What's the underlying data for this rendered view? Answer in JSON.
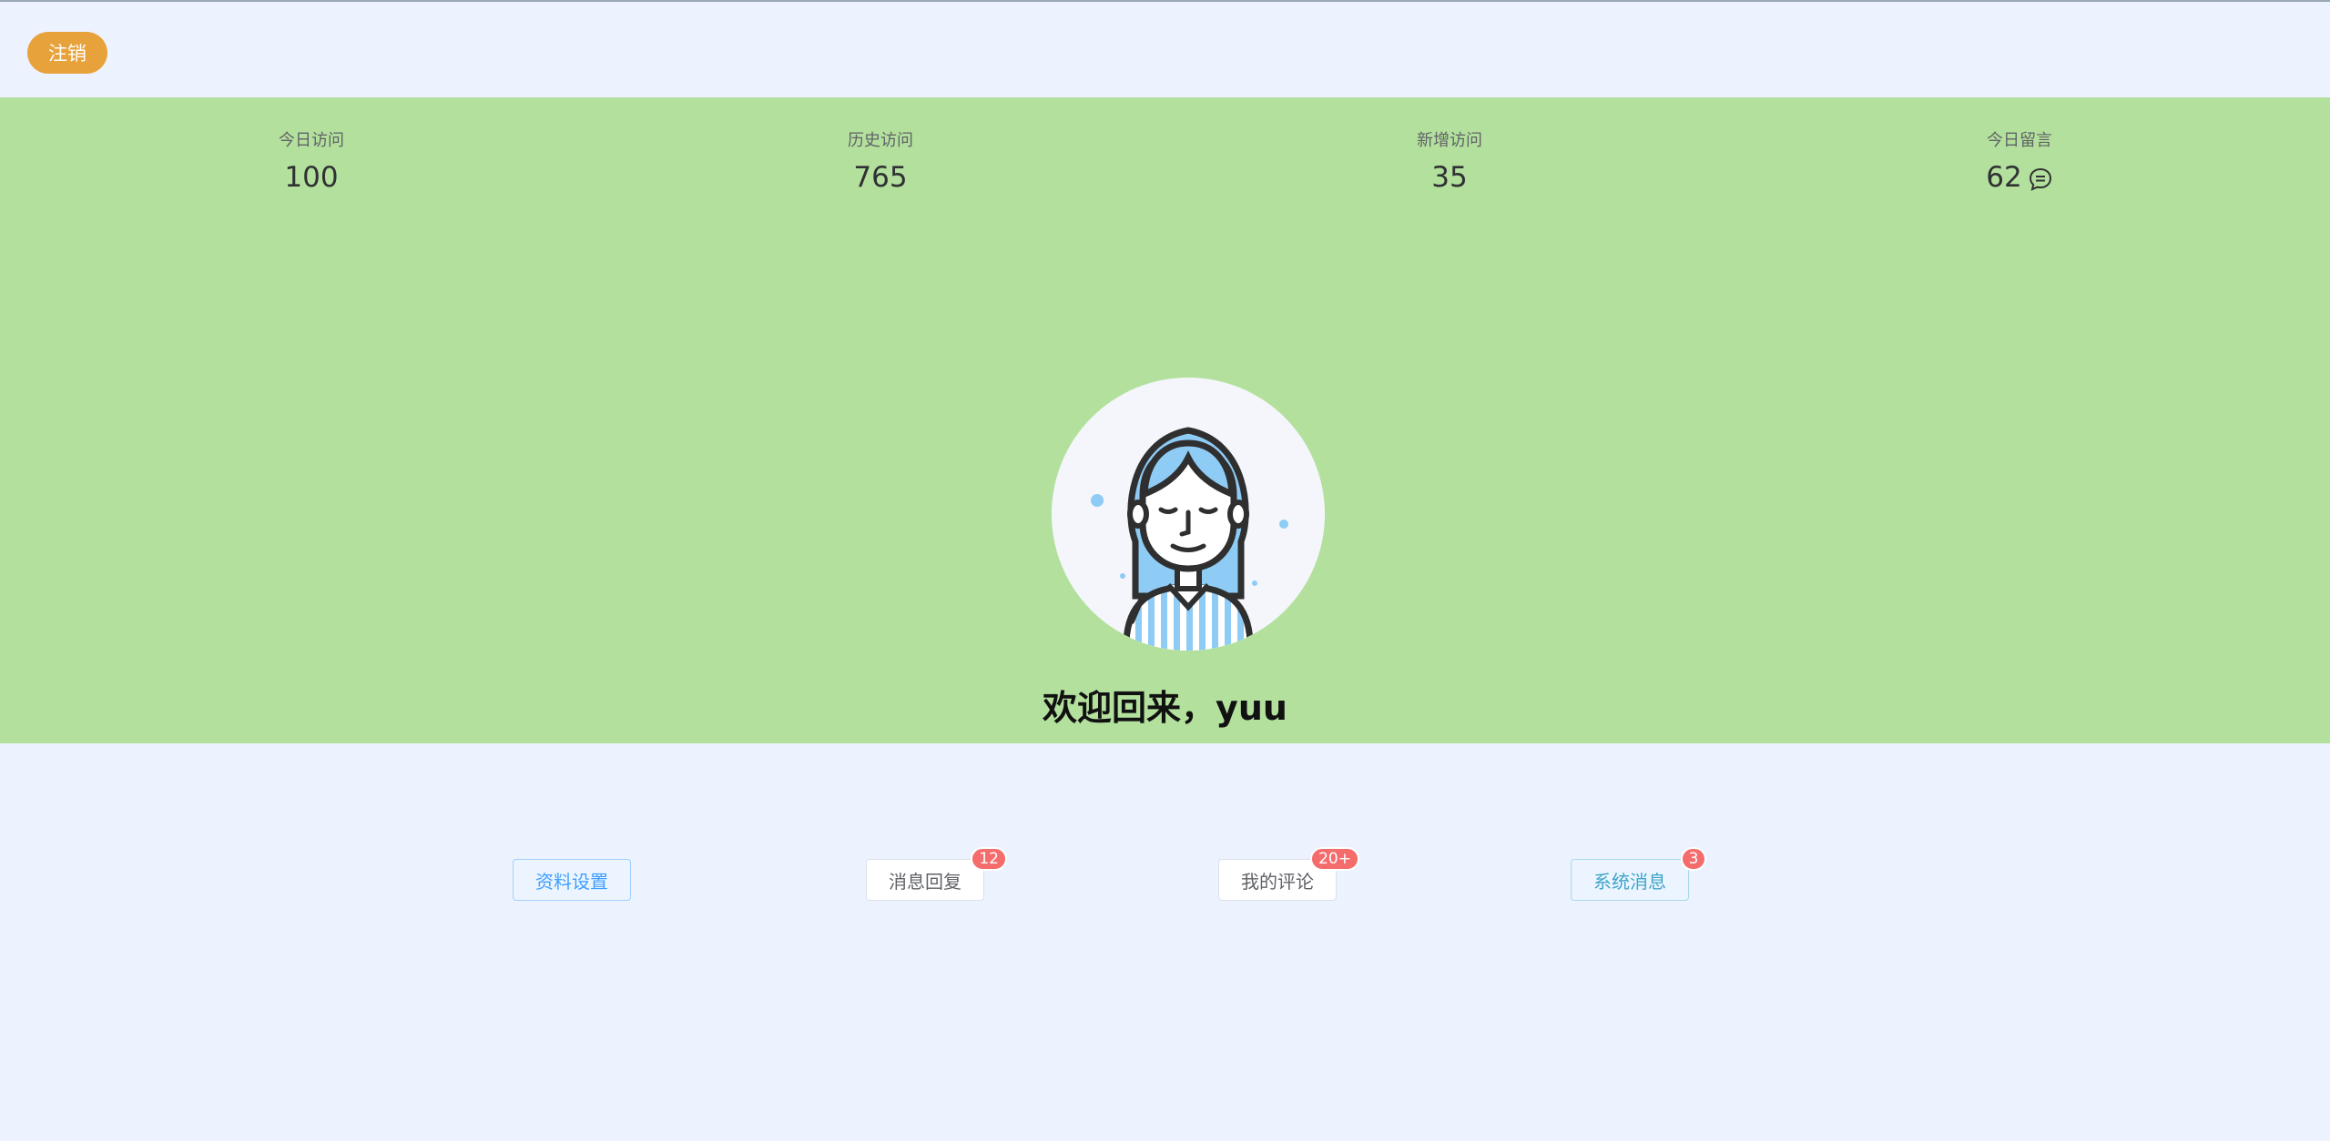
{
  "header": {
    "logout_label": "注销"
  },
  "stats": [
    {
      "label": "今日访问",
      "value": "100"
    },
    {
      "label": "历史访问",
      "value": "765"
    },
    {
      "label": "新增访问",
      "value": "35"
    },
    {
      "label": "今日留言",
      "value": "62",
      "icon": "chat-bubble-icon"
    }
  ],
  "profile": {
    "welcome": "欢迎回来，yuu",
    "avatar_icon": "woman-avatar-icon"
  },
  "actions": [
    {
      "label": "资料设置",
      "badge": ""
    },
    {
      "label": "消息回复",
      "badge": "12"
    },
    {
      "label": "我的评论",
      "badge": "20+"
    },
    {
      "label": "系统消息",
      "badge": "3"
    }
  ],
  "colors": {
    "hero_bg": "#b3e19d",
    "page_bg": "#ecf3ff",
    "logout": "#e8a23c",
    "badge": "#f56c6c",
    "primary": "#409eff"
  }
}
